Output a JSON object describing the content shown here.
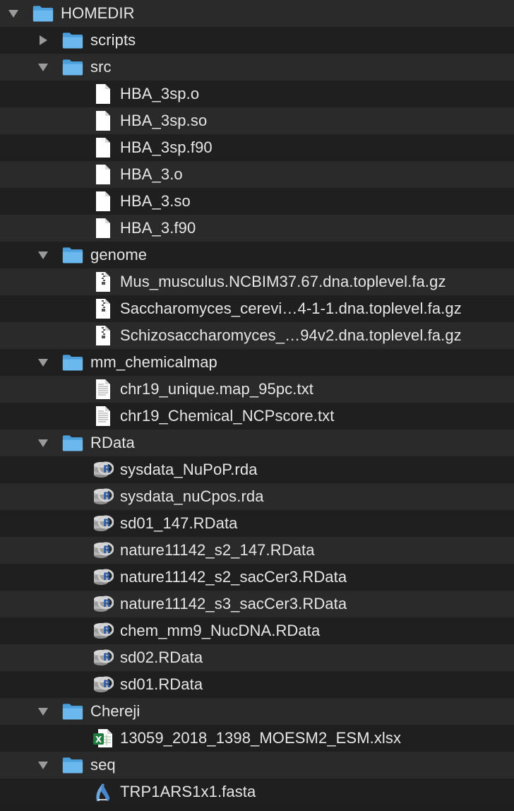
{
  "tree": {
    "root": {
      "label": "HOMEDIR",
      "expanded": true,
      "icon": "folder-icon"
    },
    "rows": [
      {
        "depth": 1,
        "type": "folder",
        "label": "scripts",
        "expanded": false
      },
      {
        "depth": 1,
        "type": "folder",
        "label": "src",
        "expanded": true
      },
      {
        "depth": 2,
        "type": "file-generic",
        "label": "HBA_3sp.o"
      },
      {
        "depth": 2,
        "type": "file-generic",
        "label": "HBA_3sp.so"
      },
      {
        "depth": 2,
        "type": "file-generic",
        "label": "HBA_3sp.f90"
      },
      {
        "depth": 2,
        "type": "file-generic",
        "label": "HBA_3.o"
      },
      {
        "depth": 2,
        "type": "file-generic",
        "label": "HBA_3.so"
      },
      {
        "depth": 2,
        "type": "file-generic",
        "label": "HBA_3.f90"
      },
      {
        "depth": 1,
        "type": "folder",
        "label": "genome",
        "expanded": true
      },
      {
        "depth": 2,
        "type": "file-archive",
        "label": "Mus_musculus.NCBIM37.67.dna.toplevel.fa.gz"
      },
      {
        "depth": 2,
        "type": "file-archive",
        "label": "Saccharomyces_cerevi…4-1-1.dna.toplevel.fa.gz"
      },
      {
        "depth": 2,
        "type": "file-archive",
        "label": "Schizosaccharomyces_…94v2.dna.toplevel.fa.gz"
      },
      {
        "depth": 1,
        "type": "folder",
        "label": "mm_chemicalmap",
        "expanded": true
      },
      {
        "depth": 2,
        "type": "file-text",
        "label": "chr19_unique.map_95pc.txt"
      },
      {
        "depth": 2,
        "type": "file-text",
        "label": "chr19_Chemical_NCPscore.txt"
      },
      {
        "depth": 1,
        "type": "folder",
        "label": "RData",
        "expanded": true
      },
      {
        "depth": 2,
        "type": "file-r",
        "label": "sysdata_NuPoP.rda"
      },
      {
        "depth": 2,
        "type": "file-r",
        "label": "sysdata_nuCpos.rda"
      },
      {
        "depth": 2,
        "type": "file-r",
        "label": "sd01_147.RData"
      },
      {
        "depth": 2,
        "type": "file-r",
        "label": "nature11142_s2_147.RData"
      },
      {
        "depth": 2,
        "type": "file-r",
        "label": "nature11142_s2_sacCer3.RData"
      },
      {
        "depth": 2,
        "type": "file-r",
        "label": "nature11142_s3_sacCer3.RData"
      },
      {
        "depth": 2,
        "type": "file-r",
        "label": "chem_mm9_NucDNA.RData"
      },
      {
        "depth": 2,
        "type": "file-r",
        "label": "sd02.RData"
      },
      {
        "depth": 2,
        "type": "file-r",
        "label": "sd01.RData"
      },
      {
        "depth": 1,
        "type": "folder",
        "label": "Chereji",
        "expanded": true
      },
      {
        "depth": 2,
        "type": "file-excel",
        "label": "13059_2018_1398_MOESM2_ESM.xlsx"
      },
      {
        "depth": 1,
        "type": "folder",
        "label": "seq",
        "expanded": true
      },
      {
        "depth": 2,
        "type": "file-fasta",
        "label": "TRP1ARS1x1.fasta"
      }
    ]
  },
  "colors": {
    "background": "#1e1e1e",
    "row_alt": "#2a2a2a",
    "folder": "#5fb0e8",
    "text": "#e6e6e6",
    "disclosure": "#9a9a9a"
  }
}
